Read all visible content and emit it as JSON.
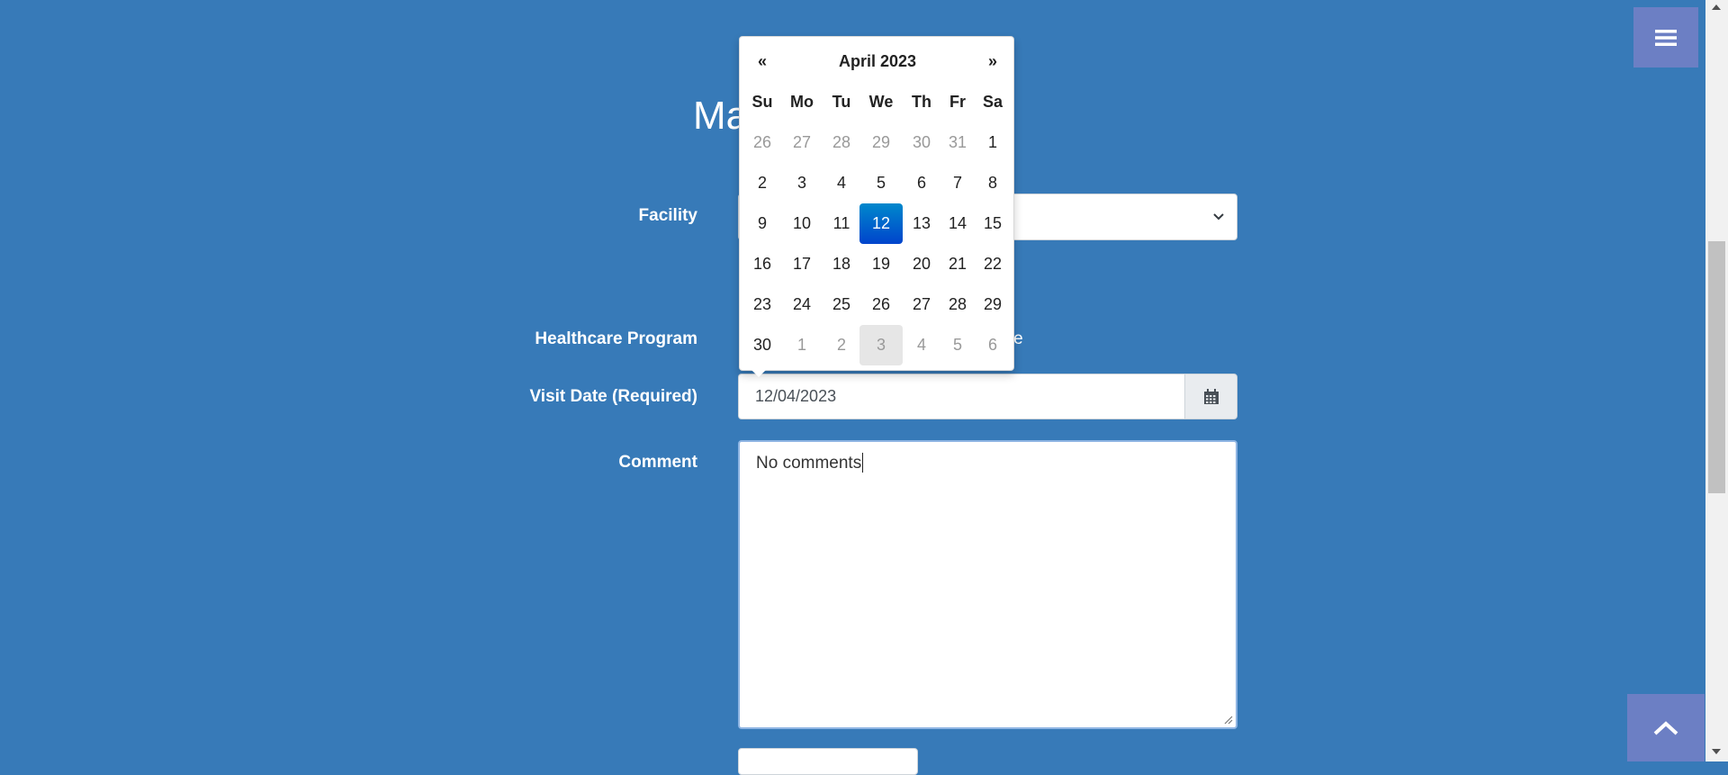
{
  "page_title": "Ma",
  "form": {
    "facility_label": "Facility",
    "healthcare_program_label": "Healthcare Program",
    "healthcare_program_value": "one",
    "visit_date_label": "Visit Date (Required)",
    "visit_date_value": "12/04/2023",
    "comment_label": "Comment",
    "comment_value": "No comments"
  },
  "datepicker": {
    "month_label": "April 2023",
    "prev": "«",
    "next": "»",
    "weekdays": [
      "Su",
      "Mo",
      "Tu",
      "We",
      "Th",
      "Fr",
      "Sa"
    ],
    "weeks": [
      [
        {
          "d": "26",
          "t": "old"
        },
        {
          "d": "27",
          "t": "old"
        },
        {
          "d": "28",
          "t": "old"
        },
        {
          "d": "29",
          "t": "old"
        },
        {
          "d": "30",
          "t": "old"
        },
        {
          "d": "31",
          "t": "old"
        },
        {
          "d": "1",
          "t": ""
        }
      ],
      [
        {
          "d": "2",
          "t": ""
        },
        {
          "d": "3",
          "t": ""
        },
        {
          "d": "4",
          "t": ""
        },
        {
          "d": "5",
          "t": ""
        },
        {
          "d": "6",
          "t": ""
        },
        {
          "d": "7",
          "t": ""
        },
        {
          "d": "8",
          "t": ""
        }
      ],
      [
        {
          "d": "9",
          "t": ""
        },
        {
          "d": "10",
          "t": ""
        },
        {
          "d": "11",
          "t": ""
        },
        {
          "d": "12",
          "t": "active"
        },
        {
          "d": "13",
          "t": ""
        },
        {
          "d": "14",
          "t": ""
        },
        {
          "d": "15",
          "t": ""
        }
      ],
      [
        {
          "d": "16",
          "t": ""
        },
        {
          "d": "17",
          "t": ""
        },
        {
          "d": "18",
          "t": ""
        },
        {
          "d": "19",
          "t": ""
        },
        {
          "d": "20",
          "t": ""
        },
        {
          "d": "21",
          "t": ""
        },
        {
          "d": "22",
          "t": ""
        }
      ],
      [
        {
          "d": "23",
          "t": ""
        },
        {
          "d": "24",
          "t": ""
        },
        {
          "d": "25",
          "t": ""
        },
        {
          "d": "26",
          "t": ""
        },
        {
          "d": "27",
          "t": ""
        },
        {
          "d": "28",
          "t": ""
        },
        {
          "d": "29",
          "t": ""
        }
      ],
      [
        {
          "d": "30",
          "t": ""
        },
        {
          "d": "1",
          "t": "new"
        },
        {
          "d": "2",
          "t": "new"
        },
        {
          "d": "3",
          "t": "new today"
        },
        {
          "d": "4",
          "t": "new"
        },
        {
          "d": "5",
          "t": "new"
        },
        {
          "d": "6",
          "t": "new"
        }
      ]
    ]
  },
  "icons": {
    "menu": "hamburger-menu-icon",
    "scroll_top": "chevron-up-icon",
    "calendar": "calendar-icon",
    "select": "chevron-down-icon"
  },
  "colors": {
    "background": "#377ab8",
    "accent_button": "#6c7fc4",
    "selected_day": "#0055cc"
  }
}
